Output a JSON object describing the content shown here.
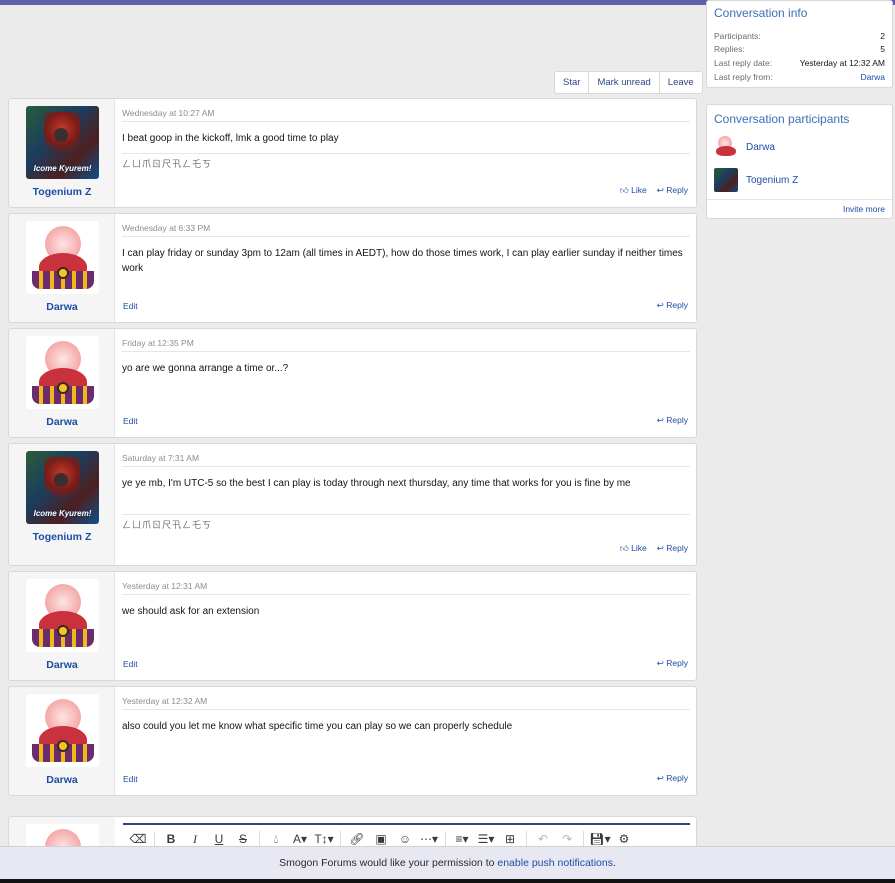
{
  "actions": {
    "star": "Star",
    "mark_unread": "Mark unread",
    "leave": "Leave"
  },
  "sidebar": {
    "info": {
      "title": "Conversation info",
      "participants_label": "Participants:",
      "participants_value": "2",
      "replies_label": "Replies:",
      "replies_value": "5",
      "last_reply_date_label": "Last reply date:",
      "last_reply_date_value": "Yesterday at 12:32 AM",
      "last_reply_from_label": "Last reply from:",
      "last_reply_from_value": "Darwa"
    },
    "participants": {
      "title": "Conversation participants",
      "list": [
        "Darwa",
        "Togenium Z"
      ],
      "invite": "Invite more"
    }
  },
  "avatar_caption": "Icome Kyurem!",
  "signature": "ㄥㄩ爪ㄖ尺卂ㄥ乇ㄎ",
  "labels": {
    "like": "Like",
    "reply": "Reply",
    "edit": "Edit"
  },
  "messages": [
    {
      "author": "Togenium Z",
      "date": "Wednesday at 10:27 AM",
      "text": "I beat goop in the kickoff, lmk a good time to play"
    },
    {
      "author": "Darwa",
      "date": "Wednesday at 6:33 PM",
      "text": "I can play friday or sunday 3pm to 12am (all times in AEDT), how do those times work, I can play earlier sunday if neither times work"
    },
    {
      "author": "Darwa",
      "date": "Friday at 12:35 PM",
      "text": "yo are we gonna arrange a time or...?"
    },
    {
      "author": "Togenium Z",
      "date": "Saturday at 7:31 AM",
      "text": "ye ye mb, I'm UTC-5 so the best I can play is today through next thursday, any time that works for you is fine by me"
    },
    {
      "author": "Darwa",
      "date": "Yesterday at 12:31 AM",
      "text": "we should ask for an extension"
    },
    {
      "author": "Darwa",
      "date": "Yesterday at 12:32 AM",
      "text": "also could you let me know what specific time you can play so we can properly schedule"
    }
  ],
  "notice": {
    "prefix": "Smogon Forums would like your permission to ",
    "link": "enable push notifications",
    "suffix": "."
  }
}
